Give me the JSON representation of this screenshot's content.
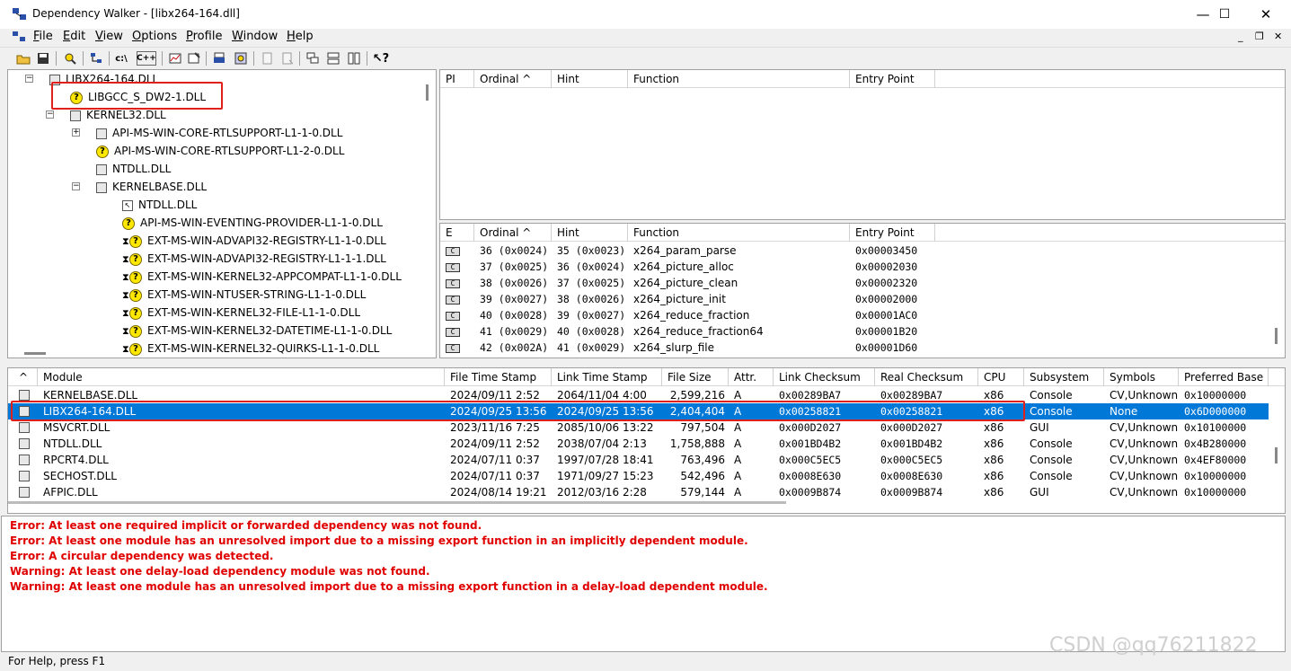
{
  "window": {
    "title": "Dependency Walker - [libx264-164.dll]",
    "controls": {
      "minimize": "—",
      "maximize": "☐",
      "close": "✕"
    },
    "mdi_controls": {
      "minimize": "_",
      "restore": "❐",
      "close": "✕"
    }
  },
  "menu": [
    {
      "label": "File",
      "key": "F",
      "rest": "ile"
    },
    {
      "label": "Edit",
      "key": "E",
      "rest": "dit"
    },
    {
      "label": "View",
      "key": "V",
      "rest": "iew"
    },
    {
      "label": "Options",
      "key": "O",
      "rest": "ptions"
    },
    {
      "label": "Profile",
      "key": "P",
      "rest": "rofile"
    },
    {
      "label": "Window",
      "key": "W",
      "rest": "indow"
    },
    {
      "label": "Help",
      "key": "H",
      "rest": "elp"
    }
  ],
  "toolbar": {
    "c_a": "c:\\",
    "c_plus": "C++"
  },
  "tree": [
    {
      "label": "LIBX264-164.DLL",
      "icon": "module-icon",
      "level": 0,
      "expander": "−"
    },
    {
      "label": "LIBGCC_S_DW2-1.DLL",
      "icon": "missing-module-icon",
      "level": 1
    },
    {
      "label": "KERNEL32.DLL",
      "icon": "module-icon",
      "level": 1,
      "expander": "−"
    },
    {
      "label": "API-MS-WIN-CORE-RTLSUPPORT-L1-1-0.DLL",
      "icon": "module-icon",
      "level": 2,
      "expander": "+"
    },
    {
      "label": "API-MS-WIN-CORE-RTLSUPPORT-L1-2-0.DLL",
      "icon": "missing-module-icon",
      "level": 2
    },
    {
      "label": "NTDLL.DLL",
      "icon": "module-icon",
      "level": 2
    },
    {
      "label": "KERNELBASE.DLL",
      "icon": "module-icon",
      "level": 2,
      "expander": "−"
    },
    {
      "label": "NTDLL.DLL",
      "icon": "forwarded-module-icon",
      "level": 3
    },
    {
      "label": "API-MS-WIN-EVENTING-PROVIDER-L1-1-0.DLL",
      "icon": "missing-module-icon",
      "level": 3
    },
    {
      "label": "EXT-MS-WIN-ADVAPI32-REGISTRY-L1-1-0.DLL",
      "icon": "delay-missing-module-icon",
      "level": 3
    },
    {
      "label": "EXT-MS-WIN-ADVAPI32-REGISTRY-L1-1-1.DLL",
      "icon": "delay-missing-module-icon",
      "level": 3
    },
    {
      "label": "EXT-MS-WIN-KERNEL32-APPCOMPAT-L1-1-0.DLL",
      "icon": "delay-missing-module-icon",
      "level": 3
    },
    {
      "label": "EXT-MS-WIN-NTUSER-STRING-L1-1-0.DLL",
      "icon": "delay-missing-module-icon",
      "level": 3
    },
    {
      "label": "EXT-MS-WIN-KERNEL32-FILE-L1-1-0.DLL",
      "icon": "delay-missing-module-icon",
      "level": 3
    },
    {
      "label": "EXT-MS-WIN-KERNEL32-DATETIME-L1-1-0.DLL",
      "icon": "delay-missing-module-icon",
      "level": 3
    },
    {
      "label": "EXT-MS-WIN-KERNEL32-QUIRKS-L1-1-0.DLL",
      "icon": "delay-missing-module-icon",
      "level": 3
    }
  ],
  "imports": {
    "headers": [
      "PI",
      "Ordinal ^",
      "Hint",
      "Function",
      "Entry Point"
    ]
  },
  "exports": {
    "headers": [
      "E",
      "Ordinal ^",
      "Hint",
      "Function",
      "Entry Point"
    ],
    "rows": [
      {
        "ordinal": "36 (0x0024)",
        "hint": "35 (0x0023)",
        "function": "x264_param_parse",
        "entry": "0x00003450"
      },
      {
        "ordinal": "37 (0x0025)",
        "hint": "36 (0x0024)",
        "function": "x264_picture_alloc",
        "entry": "0x00002030"
      },
      {
        "ordinal": "38 (0x0026)",
        "hint": "37 (0x0025)",
        "function": "x264_picture_clean",
        "entry": "0x00002320"
      },
      {
        "ordinal": "39 (0x0027)",
        "hint": "38 (0x0026)",
        "function": "x264_picture_init",
        "entry": "0x00002000"
      },
      {
        "ordinal": "40 (0x0028)",
        "hint": "39 (0x0027)",
        "function": "x264_reduce_fraction",
        "entry": "0x00001AC0"
      },
      {
        "ordinal": "41 (0x0029)",
        "hint": "40 (0x0028)",
        "function": "x264_reduce_fraction64",
        "entry": "0x00001B20"
      },
      {
        "ordinal": "42 (0x002A)",
        "hint": "41 (0x0029)",
        "function": "x264_slurp_file",
        "entry": "0x00001D60"
      }
    ]
  },
  "modules": {
    "headers": [
      "^",
      "Module",
      "File Time Stamp",
      "Link Time Stamp",
      "File Size",
      "Attr.",
      "Link Checksum",
      "Real Checksum",
      "CPU",
      "Subsystem",
      "Symbols",
      "Preferred Base"
    ],
    "rows": [
      {
        "module": "KERNELBASE.DLL",
        "fts": "2024/09/11  2:52",
        "lts": "2064/11/04  4:00",
        "size": "2,599,216",
        "attr": "A",
        "lck": "0x00289BA7",
        "rck": "0x00289BA7",
        "cpu": "x86",
        "sub": "Console",
        "sym": "CV,Unknown",
        "base": "0x10000000"
      },
      {
        "module": "LIBX264-164.DLL",
        "fts": "2024/09/25 13:56",
        "lts": "2024/09/25 13:56",
        "size": "2,404,404",
        "attr": "A",
        "lck": "0x00258821",
        "rck": "0x00258821",
        "cpu": "x86",
        "sub": "Console",
        "sym": "None",
        "base": "0x6D000000",
        "selected": true
      },
      {
        "module": "MSVCRT.DLL",
        "fts": "2023/11/16  7:25",
        "lts": "2085/10/06 13:22",
        "size": "797,504",
        "attr": "A",
        "lck": "0x000D2027",
        "rck": "0x000D2027",
        "cpu": "x86",
        "sub": "GUI",
        "sym": "CV,Unknown",
        "base": "0x10100000"
      },
      {
        "module": "NTDLL.DLL",
        "fts": "2024/09/11  2:52",
        "lts": "2038/07/04  2:13",
        "size": "1,758,888",
        "attr": "A",
        "lck": "0x001BD4B2",
        "rck": "0x001BD4B2",
        "cpu": "x86",
        "sub": "Console",
        "sym": "CV,Unknown",
        "base": "0x4B280000"
      },
      {
        "module": "RPCRT4.DLL",
        "fts": "2024/07/11  0:37",
        "lts": "1997/07/28 18:41",
        "size": "763,496",
        "attr": "A",
        "lck": "0x000C5EC5",
        "rck": "0x000C5EC5",
        "cpu": "x86",
        "sub": "Console",
        "sym": "CV,Unknown",
        "base": "0x4EF80000"
      },
      {
        "module": "SECHOST.DLL",
        "fts": "2024/07/11  0:37",
        "lts": "1971/09/27 15:23",
        "size": "542,496",
        "attr": "A",
        "lck": "0x0008E630",
        "rck": "0x0008E630",
        "cpu": "x86",
        "sub": "Console",
        "sym": "CV,Unknown",
        "base": "0x10000000"
      },
      {
        "module": "AFPIC.DLL",
        "fts": "2024/08/14 19:21",
        "lts": "2012/03/16  2:28",
        "size": "579,144",
        "attr": "A",
        "lck": "0x0009B874",
        "rck": "0x0009B874",
        "cpu": "x86",
        "sub": "GUI",
        "sym": "CV,Unknown",
        "base": "0x10000000"
      }
    ]
  },
  "log": [
    "Error: At least one required implicit or forwarded dependency was not found.",
    "Error: At least one module has an unresolved import due to a missing export function in an implicitly dependent module.",
    "Error: A circular dependency was detected.",
    "Warning: At least one delay-load dependency module was not found.",
    "Warning: At least one module has an unresolved import due to a missing export function in a delay-load dependent module."
  ],
  "status": "For Help, press F1",
  "watermark": "CSDN @qq76211822",
  "colors": {
    "error": "#e00000",
    "selection": "#0078d7",
    "highlight_box": "#e0201a"
  }
}
